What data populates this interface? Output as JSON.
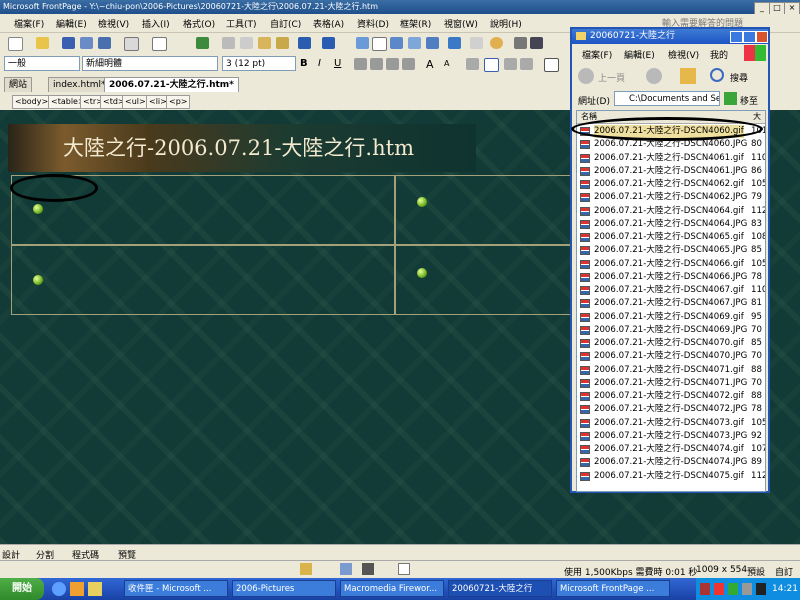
{
  "window": {
    "title": "Microsoft FrontPage - Y:\\~chiu-pon\\2006-Pictures\\20060721-大陸之行\\2006.07.21-大陸之行.htm",
    "help_placeholder": "輸入需要解答的問題"
  },
  "menu": [
    "檔案(F)",
    "編輯(E)",
    "檢視(V)",
    "插入(I)",
    "格式(O)",
    "工具(T)",
    "自訂(C)",
    "表格(A)",
    "資料(D)",
    "框架(R)",
    "視窗(W)",
    "說明(H)"
  ],
  "format_bar": {
    "style": "一般",
    "font": "新細明體",
    "size": "3  (12 pt)",
    "bold": "B",
    "italic": "I",
    "underline": "U",
    "grow": "A",
    "shrink": "A"
  },
  "doc_tabs": [
    "網站",
    "index.html*",
    "2006.07.21-大陸之行.htm*"
  ],
  "tag_selector": [
    "<body>",
    "<table>",
    "<tr>",
    "<td>",
    "<ul>",
    "<li>",
    "<p>"
  ],
  "page": {
    "banner_title": "大陸之行-2006.07.21-大陸之行.htm"
  },
  "explorer": {
    "title": "20060721-大陸之行",
    "menu": [
      "檔案(F)",
      "編輯(E)",
      "檢視(V)",
      "我的"
    ],
    "back_label": "上一頁",
    "search_label": "搜尋",
    "address_label": "網址(D)",
    "address_value": "C:\\Documents and Set",
    "go_label": "移至",
    "col_name": "名稱",
    "col_size": "大",
    "files": [
      {
        "name": "2006.07.21-大陸之行-DSCN4060.gif",
        "size": "101"
      },
      {
        "name": "2006.07.21-大陸之行-DSCN4060.JPG",
        "size": "80"
      },
      {
        "name": "2006.07.21-大陸之行-DSCN4061.gif",
        "size": "110"
      },
      {
        "name": "2006.07.21-大陸之行-DSCN4061.JPG",
        "size": "86"
      },
      {
        "name": "2006.07.21-大陸之行-DSCN4062.gif",
        "size": "105"
      },
      {
        "name": "2006.07.21-大陸之行-DSCN4062.JPG",
        "size": "79"
      },
      {
        "name": "2006.07.21-大陸之行-DSCN4064.gif",
        "size": "112"
      },
      {
        "name": "2006.07.21-大陸之行-DSCN4064.JPG",
        "size": "83"
      },
      {
        "name": "2006.07.21-大陸之行-DSCN4065.gif",
        "size": "108"
      },
      {
        "name": "2006.07.21-大陸之行-DSCN4065.JPG",
        "size": "85"
      },
      {
        "name": "2006.07.21-大陸之行-DSCN4066.gif",
        "size": "105"
      },
      {
        "name": "2006.07.21-大陸之行-DSCN4066.JPG",
        "size": "78"
      },
      {
        "name": "2006.07.21-大陸之行-DSCN4067.gif",
        "size": "110"
      },
      {
        "name": "2006.07.21-大陸之行-DSCN4067.JPG",
        "size": "81"
      },
      {
        "name": "2006.07.21-大陸之行-DSCN4069.gif",
        "size": "95"
      },
      {
        "name": "2006.07.21-大陸之行-DSCN4069.JPG",
        "size": "70"
      },
      {
        "name": "2006.07.21-大陸之行-DSCN4070.gif",
        "size": "85"
      },
      {
        "name": "2006.07.21-大陸之行-DSCN4070.JPG",
        "size": "70"
      },
      {
        "name": "2006.07.21-大陸之行-DSCN4071.gif",
        "size": "88"
      },
      {
        "name": "2006.07.21-大陸之行-DSCN4071.JPG",
        "size": "70"
      },
      {
        "name": "2006.07.21-大陸之行-DSCN4072.gif",
        "size": "88"
      },
      {
        "name": "2006.07.21-大陸之行-DSCN4072.JPG",
        "size": "78"
      },
      {
        "name": "2006.07.21-大陸之行-DSCN4073.gif",
        "size": "105"
      },
      {
        "name": "2006.07.21-大陸之行-DSCN4073.JPG",
        "size": "92"
      },
      {
        "name": "2006.07.21-大陸之行-DSCN4074.gif",
        "size": "107"
      },
      {
        "name": "2006.07.21-大陸之行-DSCN4074.JPG",
        "size": "89"
      },
      {
        "name": "2006.07.21-大陸之行-DSCN4075.gif",
        "size": "112"
      }
    ]
  },
  "view_tabs": [
    "設計",
    "分割",
    "程式碼",
    "預覽"
  ],
  "status": {
    "speed": "使用 1,500Kbps 需費時 0:01 秒",
    "dimensions": "1009 x 554",
    "mode": "預設",
    "custom": "自訂"
  },
  "taskbar": {
    "start": "開始",
    "tasks": [
      "收件匣 - Microsoft ...",
      "2006-Pictures",
      "Macromedia Firewor...",
      "20060721-大陸之行",
      "Microsoft FrontPage ..."
    ],
    "clock": "14:21"
  }
}
